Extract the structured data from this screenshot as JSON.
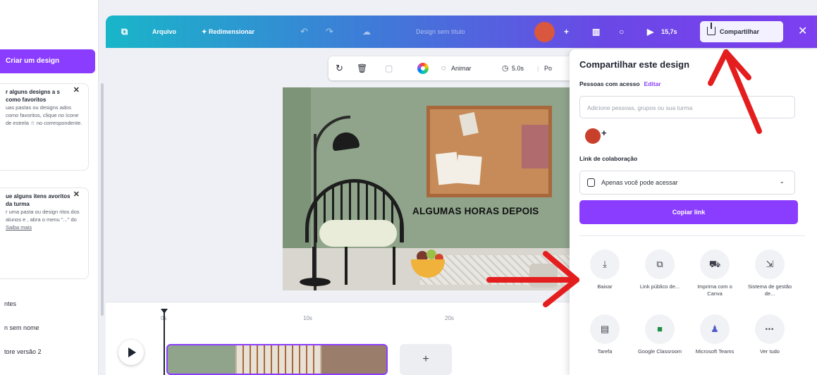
{
  "sidebar": {
    "create_label": "Criar um design",
    "tip1": {
      "title": "r alguns designs a s como favoritos",
      "body": "uas pastas ou designs ados como favoritos, clique no ícone de estrela ☆ no correspondente."
    },
    "tip2": {
      "title": "ue alguns itens avoritos da turma",
      "body": "r uma pasta ou design ritos dos alunos e , abra o menu \"...\" do",
      "link": "Saiba mais"
    },
    "items": [
      "ntes",
      "n sem nome",
      "tore versão 2"
    ]
  },
  "topbar": {
    "file_label": "Arquivo",
    "resize_label": "✦ Redimensionar",
    "title": "Design sem título",
    "present_label": "15,7s",
    "share_label": "Compartilhar",
    "close_glyph": "✕"
  },
  "canvas_toolbar": {
    "animate_label": "Animar",
    "duration_label": "5.0s",
    "position_label": "Po"
  },
  "design": {
    "headline": "ALGUMAS HORAS DEPOIS"
  },
  "timeline": {
    "ticks": [
      "0s",
      "10s",
      "20s"
    ],
    "add_glyph": "+"
  },
  "share_panel": {
    "title": "Compartilhar este design",
    "people_label": "Pessoas com acesso",
    "edit_label": "Editar",
    "input_placeholder": "Adicione pessoas, grupos ou sua turma",
    "add_person_glyph": "+",
    "collab_link_label": "Link de colaboração",
    "access_value": "Apenas você pode acessar",
    "copy_link_label": "Copiar link",
    "options": [
      {
        "label": "Baixar",
        "icon": "download-icon",
        "glyph": "⤓"
      },
      {
        "label": "Link público de...",
        "icon": "link-icon",
        "glyph": "⧉"
      },
      {
        "label": "Imprima com o Canva",
        "icon": "truck-icon",
        "glyph": "⛟"
      },
      {
        "label": "Sistema de gestão de...",
        "icon": "lms-icon",
        "glyph": "⇲"
      },
      {
        "label": "Tarefa",
        "icon": "assignment-icon",
        "glyph": "▤"
      },
      {
        "label": "Google Classroom",
        "icon": "google-classroom-icon",
        "glyph": "■"
      },
      {
        "label": "Microsoft Teams",
        "icon": "microsoft-teams-icon",
        "glyph": "♟"
      },
      {
        "label": "Ver tudo",
        "icon": "more-icon",
        "glyph": "•••"
      }
    ]
  },
  "colors": {
    "accent": "#8b3dff",
    "annotation_red": "#e41e1e"
  }
}
